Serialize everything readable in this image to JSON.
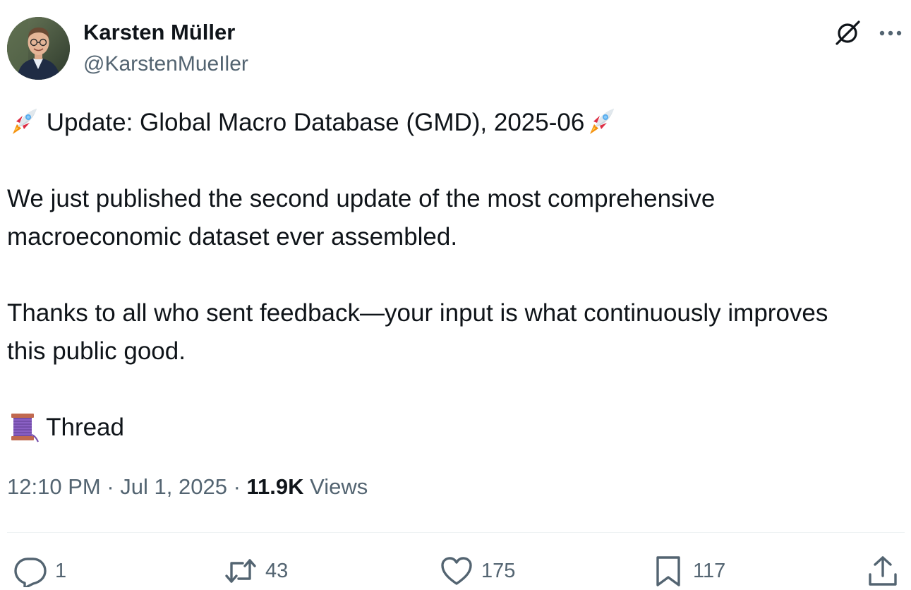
{
  "author": {
    "display_name": "Karsten Müller",
    "handle": "@KarstenMueIler"
  },
  "tweet": {
    "line1": "Update: Global Macro Database (GMD), 2025-06",
    "line2": "We just published the second update of the most comprehensive",
    "line3": "macroeconomic dataset ever assembled.",
    "line4": "Thanks to all who sent feedback—your input is what continuously improves",
    "line5": "this public good.",
    "line6": "Thread",
    "emojis": [
      "rocket-emoji",
      "rocket-emoji",
      "spool-of-thread-emoji"
    ]
  },
  "meta": {
    "time": "12:10 PM",
    "separator1": "·",
    "date": "Jul 1, 2025",
    "separator2": "·",
    "views_count": "11.9K",
    "views_label": "Views"
  },
  "actions": {
    "reply_count": "1",
    "retweet_count": "43",
    "like_count": "175",
    "bookmark_count": "117"
  },
  "colors": {
    "text_primary": "#0f1419",
    "text_secondary": "#536471",
    "divider": "#eff3f4"
  },
  "icons": {
    "header": [
      "grok-icon",
      "more-icon"
    ],
    "actions": [
      "reply-icon",
      "retweet-icon",
      "like-icon",
      "bookmark-icon",
      "share-icon"
    ]
  }
}
